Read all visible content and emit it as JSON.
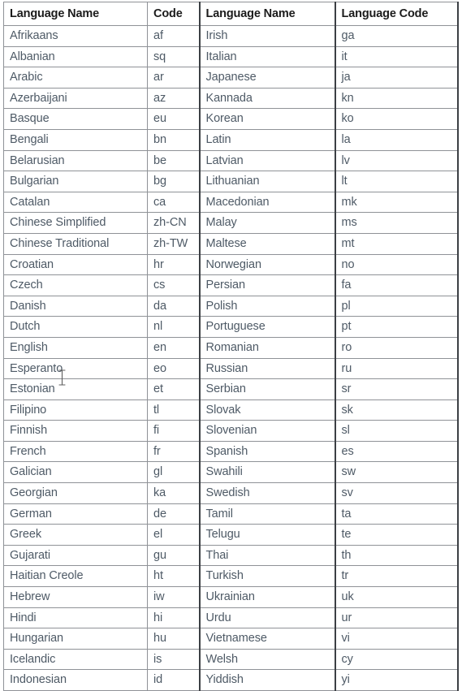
{
  "table": {
    "headers": [
      "Language Name",
      "Code",
      "Language Name",
      "Language Code"
    ],
    "rows": [
      [
        "Afrikaans",
        "af",
        "Irish",
        "ga"
      ],
      [
        "Albanian",
        "sq",
        "Italian",
        "it"
      ],
      [
        "Arabic",
        "ar",
        "Japanese",
        "ja"
      ],
      [
        "Azerbaijani",
        "az",
        "Kannada",
        "kn"
      ],
      [
        "Basque",
        "eu",
        "Korean",
        "ko"
      ],
      [
        "Bengali",
        "bn",
        "Latin",
        "la"
      ],
      [
        "Belarusian",
        "be",
        "Latvian",
        "lv"
      ],
      [
        "Bulgarian",
        "bg",
        "Lithuanian",
        "lt"
      ],
      [
        "Catalan",
        "ca",
        "Macedonian",
        "mk"
      ],
      [
        "Chinese Simplified",
        "zh-CN",
        "Malay",
        "ms"
      ],
      [
        "Chinese Traditional",
        "zh-TW",
        "Maltese",
        "mt"
      ],
      [
        "Croatian",
        "hr",
        "Norwegian",
        "no"
      ],
      [
        "Czech",
        "cs",
        "Persian",
        "fa"
      ],
      [
        "Danish",
        "da",
        "Polish",
        "pl"
      ],
      [
        "Dutch",
        "nl",
        "Portuguese",
        "pt"
      ],
      [
        "English",
        "en",
        "Romanian",
        "ro"
      ],
      [
        "Esperanto",
        "eo",
        "Russian",
        "ru"
      ],
      [
        "Estonian",
        "et",
        "Serbian",
        "sr"
      ],
      [
        "Filipino",
        "tl",
        "Slovak",
        "sk"
      ],
      [
        "Finnish",
        "fi",
        "Slovenian",
        "sl"
      ],
      [
        "French",
        "fr",
        "Spanish",
        "es"
      ],
      [
        "Galician",
        "gl",
        "Swahili",
        "sw"
      ],
      [
        "Georgian",
        "ka",
        "Swedish",
        "sv"
      ],
      [
        "German",
        "de",
        "Tamil",
        "ta"
      ],
      [
        "Greek",
        "el",
        "Telugu",
        "te"
      ],
      [
        "Gujarati",
        "gu",
        "Thai",
        "th"
      ],
      [
        "Haitian Creole",
        "ht",
        "Turkish",
        "tr"
      ],
      [
        "Hebrew",
        "iw",
        "Ukrainian",
        "uk"
      ],
      [
        "Hindi",
        "hi",
        "Urdu",
        "ur"
      ],
      [
        "Hungarian",
        "hu",
        "Vietnamese",
        "vi"
      ],
      [
        "Icelandic",
        "is",
        "Welsh",
        "cy"
      ],
      [
        "Indonesian",
        "id",
        "Yiddish",
        "yi"
      ]
    ]
  },
  "colors": {
    "header_text": "#1b1b1b",
    "body_text": "#4e5a66",
    "grid_line": "#8f9297",
    "major_rule": "#3c3f44",
    "background": "#ffffff"
  },
  "cursor": {
    "icon": "text-ibeam-cursor"
  }
}
